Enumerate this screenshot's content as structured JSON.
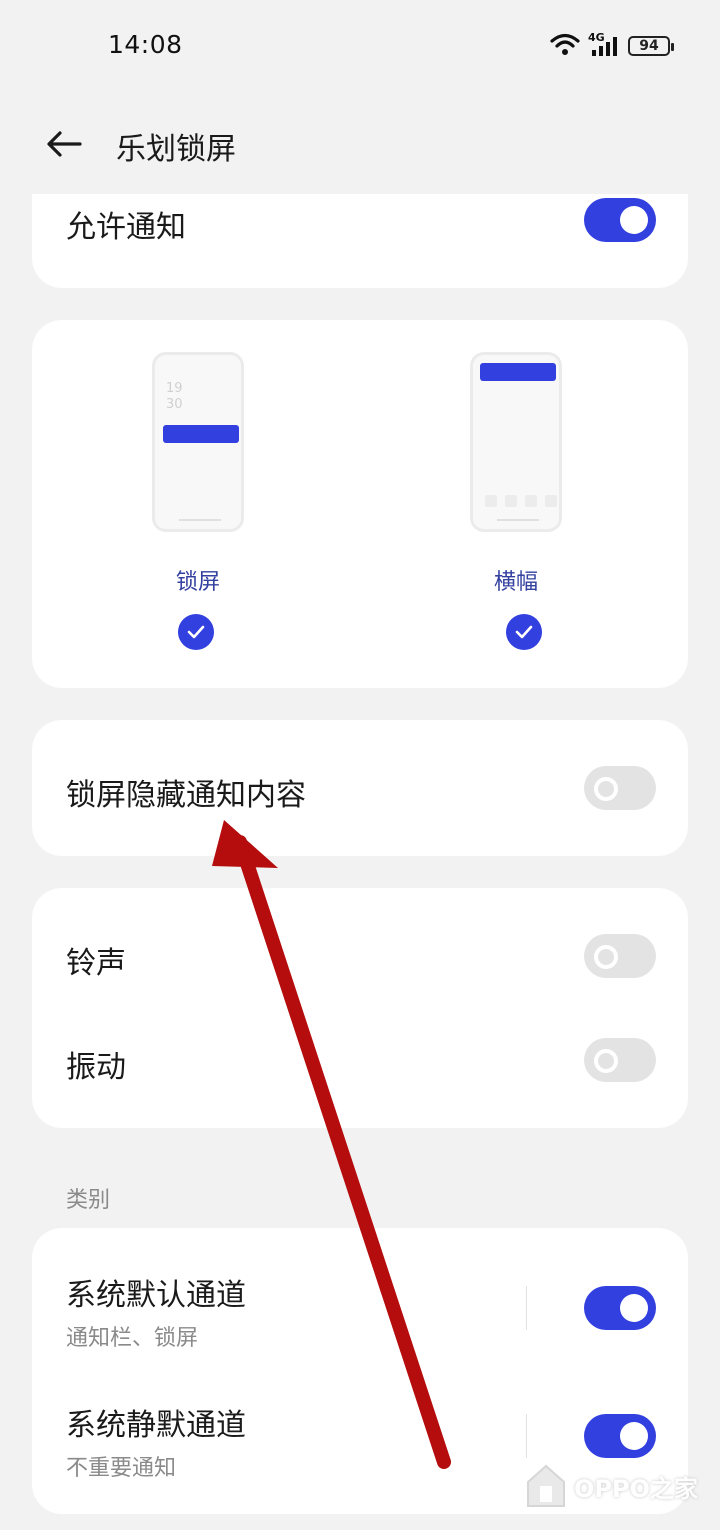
{
  "status_bar": {
    "time": "14:08",
    "network": "4G",
    "battery": "94"
  },
  "header": {
    "title": "乐划锁屏"
  },
  "allow_notifications": {
    "label": "允许通知",
    "enabled": true
  },
  "display_options": {
    "items": [
      {
        "label": "锁屏",
        "clock_line1": "19",
        "clock_line2": "30",
        "checked": true
      },
      {
        "label": "横幅",
        "checked": true
      }
    ]
  },
  "hide_content": {
    "label": "锁屏隐藏通知内容",
    "enabled": false
  },
  "sound_vibration": [
    {
      "label": "铃声",
      "enabled": false
    },
    {
      "label": "振动",
      "enabled": false
    }
  ],
  "category": {
    "title": "类别",
    "channels": [
      {
        "label": "系统默认通道",
        "sub": "通知栏、锁屏",
        "enabled": true
      },
      {
        "label": "系统静默通道",
        "sub": "不重要通知",
        "enabled": true
      }
    ]
  },
  "annotation": {
    "arrow_color": "#b50d0d"
  },
  "accent_color": "#3340e0",
  "watermark": {
    "text": "OPPO之家"
  }
}
